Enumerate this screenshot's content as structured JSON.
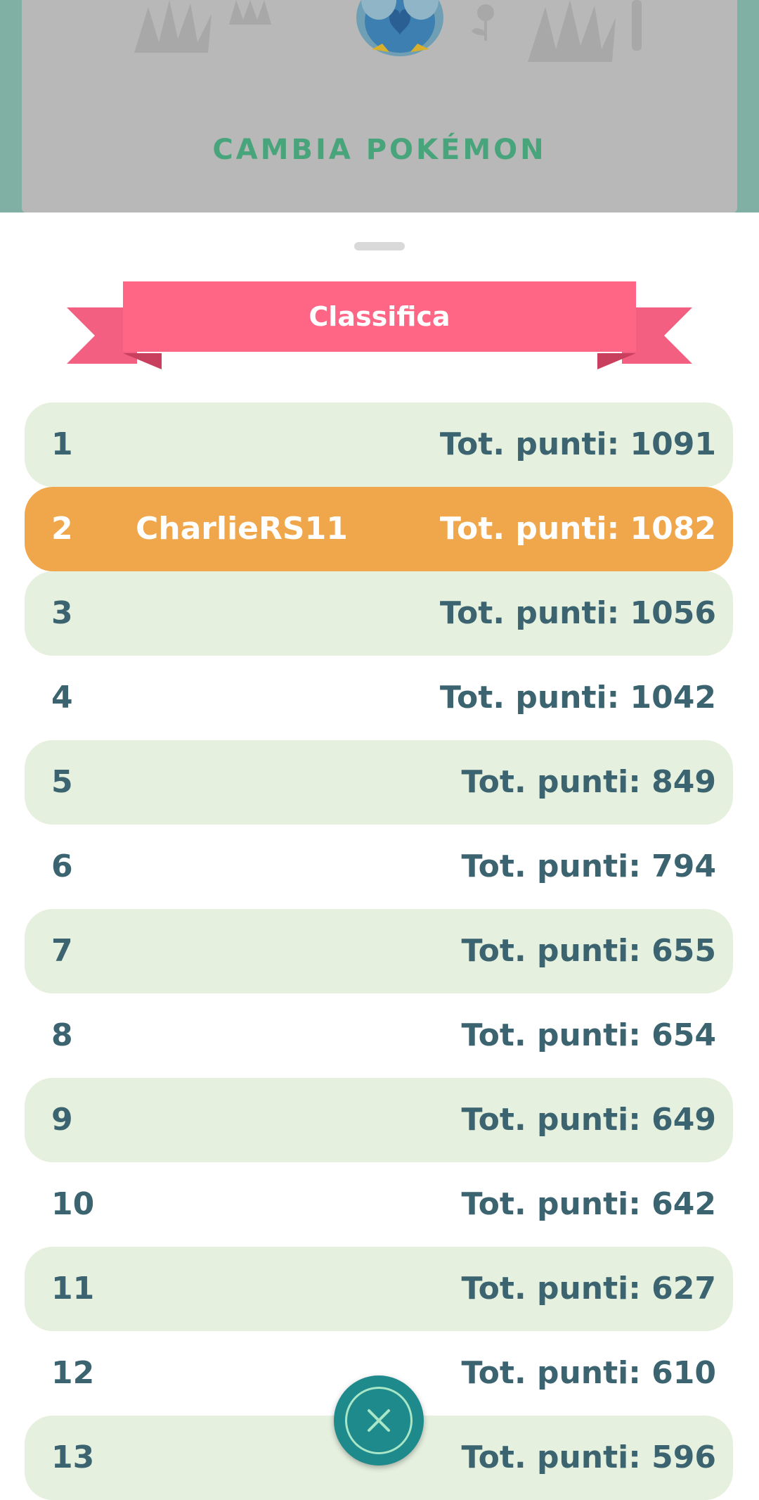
{
  "scene": {
    "change_pokemon_label": "CAMBIA POKÉMON"
  },
  "leaderboard": {
    "title": "Classifica",
    "rows": [
      {
        "rank": "1",
        "name": "",
        "score": "Tot. punti: 1091"
      },
      {
        "rank": "2",
        "name": "CharlieRS11",
        "score": "Tot. punti: 1082"
      },
      {
        "rank": "3",
        "name": "",
        "score": "Tot. punti: 1056"
      },
      {
        "rank": "4",
        "name": "",
        "score": "Tot. punti: 1042"
      },
      {
        "rank": "5",
        "name": "",
        "score": "Tot. punti: 849"
      },
      {
        "rank": "6",
        "name": "",
        "score": "Tot. punti: 794"
      },
      {
        "rank": "7",
        "name": "",
        "score": "Tot. punti: 655"
      },
      {
        "rank": "8",
        "name": "",
        "score": "Tot. punti: 654"
      },
      {
        "rank": "9",
        "name": "",
        "score": "Tot. punti: 649"
      },
      {
        "rank": "10",
        "name": "",
        "score": "Tot. punti: 642"
      },
      {
        "rank": "11",
        "name": "",
        "score": "Tot. punti: 627"
      },
      {
        "rank": "12",
        "name": "",
        "score": "Tot. punti: 610"
      },
      {
        "rank": "13",
        "name": "",
        "score": "Tot. punti: 596"
      }
    ]
  },
  "icons": {
    "close": "close-icon",
    "pokemon": "pokemon-sprite-icon"
  },
  "colors": {
    "banner": "#ff6584",
    "highlight_row": "#f0a64b",
    "alt_row": "#e5f0df",
    "text": "#3b6470",
    "accent_green": "#48a47b",
    "close_button": "#1e8a8b"
  }
}
